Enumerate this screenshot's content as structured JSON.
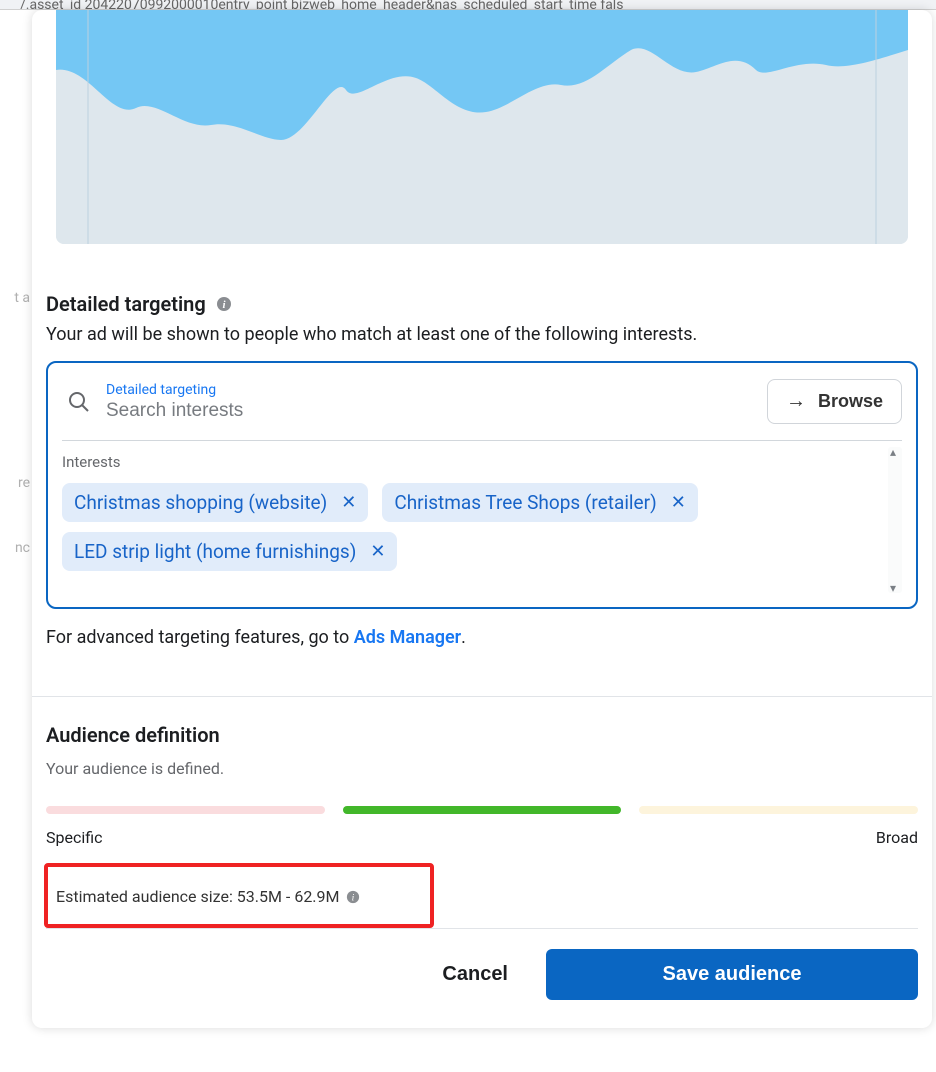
{
  "url_bar": "/.asset_id  20422070992000010entry_point  bizweb_home_header&nas_scheduled_start_time  fals",
  "bg_text_1": "t a",
  "bg_text_2": "re",
  "bg_text_3": "nc",
  "section": {
    "title": "Detailed targeting",
    "subtitle": "Your ad will be shown to people who match at least one of the following interests."
  },
  "search": {
    "label": "Detailed targeting",
    "placeholder": "Search interests",
    "browse_label": "Browse"
  },
  "interests": {
    "header": "Interests",
    "chips": [
      "Christmas shopping (website)",
      "Christmas Tree Shops (retailer)",
      "LED strip light (home furnishings)"
    ]
  },
  "advanced": {
    "text1": "For advanced targeting features, go to ",
    "link": "Ads Manager",
    "text2": "."
  },
  "audience": {
    "title": "Audience definition",
    "sub": "Your audience is defined.",
    "left": "Specific",
    "right": "Broad",
    "estimate": "Estimated audience size: 53.5M - 62.9M"
  },
  "footer": {
    "cancel": "Cancel",
    "save": "Save audience"
  }
}
